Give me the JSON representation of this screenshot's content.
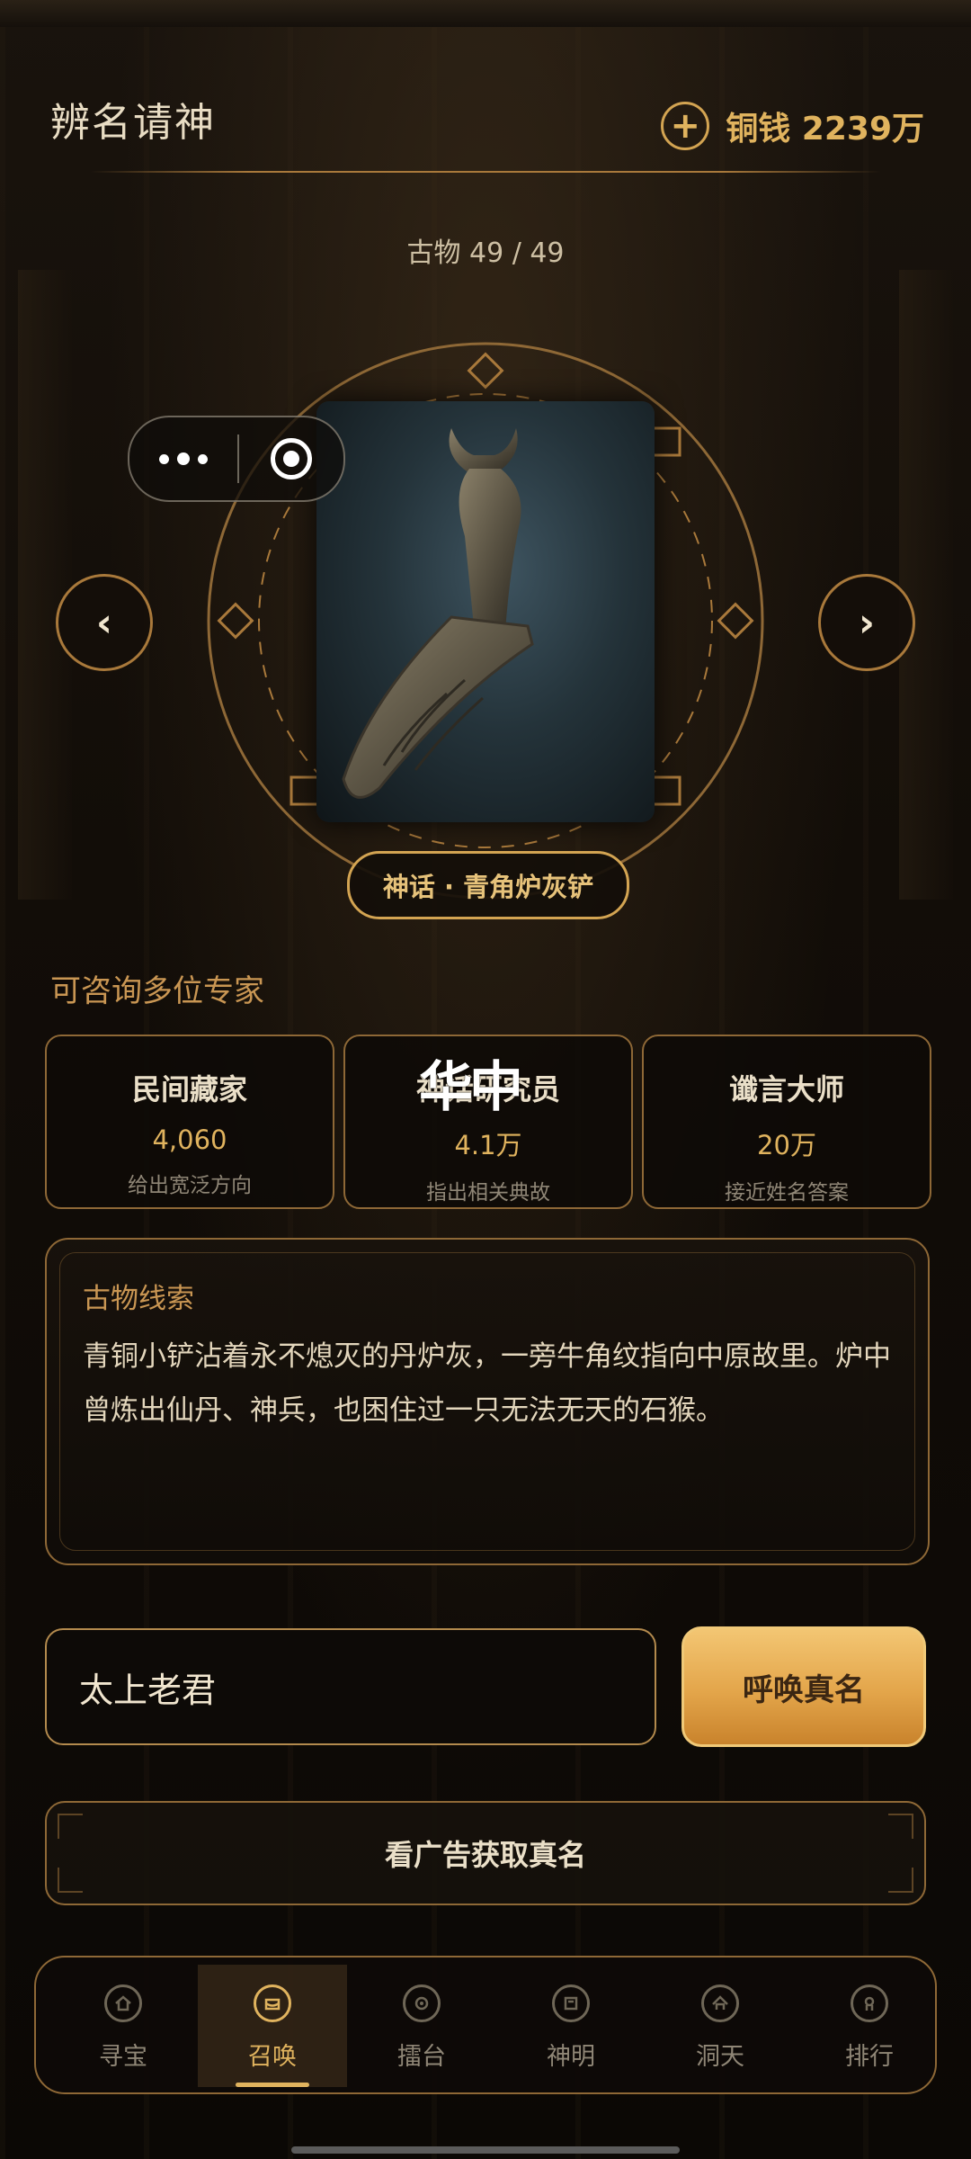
{
  "header": {
    "title": "辨名请神",
    "currency_label": "铜钱",
    "currency_value": "2239万"
  },
  "relic": {
    "counter": "古物 49 / 49",
    "name": "神话 · 青角炉灰铲"
  },
  "experts": {
    "section_title": "可咨询多位专家",
    "items": [
      {
        "title": "民间藏家",
        "price": "4,060",
        "desc": "给出宽泛方向"
      },
      {
        "title": "神话研究员",
        "price": "4.1万",
        "desc": "指出相关典故"
      },
      {
        "title": "谶言大师",
        "price": "20万",
        "desc": "接近姓名答案"
      }
    ],
    "overlay_text": "华中"
  },
  "clue": {
    "title": "古物线索",
    "text": "青铜小铲沾着永不熄灭的丹炉灰，一旁牛角纹指向中原故里。炉中曾炼出仙丹、神兵，也困住过一只无法无天的石猴。"
  },
  "answer": {
    "value": "太上老君",
    "summon_label": "呼唤真名",
    "ad_label": "看广告获取真名"
  },
  "tabs": [
    {
      "label": "寻宝",
      "icon": "treasure-icon",
      "active": false
    },
    {
      "label": "召唤",
      "icon": "summon-icon",
      "active": true
    },
    {
      "label": "擂台",
      "icon": "arena-icon",
      "active": false
    },
    {
      "label": "神明",
      "icon": "deity-icon",
      "active": false
    },
    {
      "label": "洞天",
      "icon": "cave-heaven-icon",
      "active": false
    },
    {
      "label": "排行",
      "icon": "ranking-icon",
      "active": false
    }
  ],
  "theme": {
    "accent": "#e0b35e",
    "border": "#8e6836",
    "button_gradient_top": "#f3c673",
    "button_gradient_bottom": "#c9832c"
  }
}
